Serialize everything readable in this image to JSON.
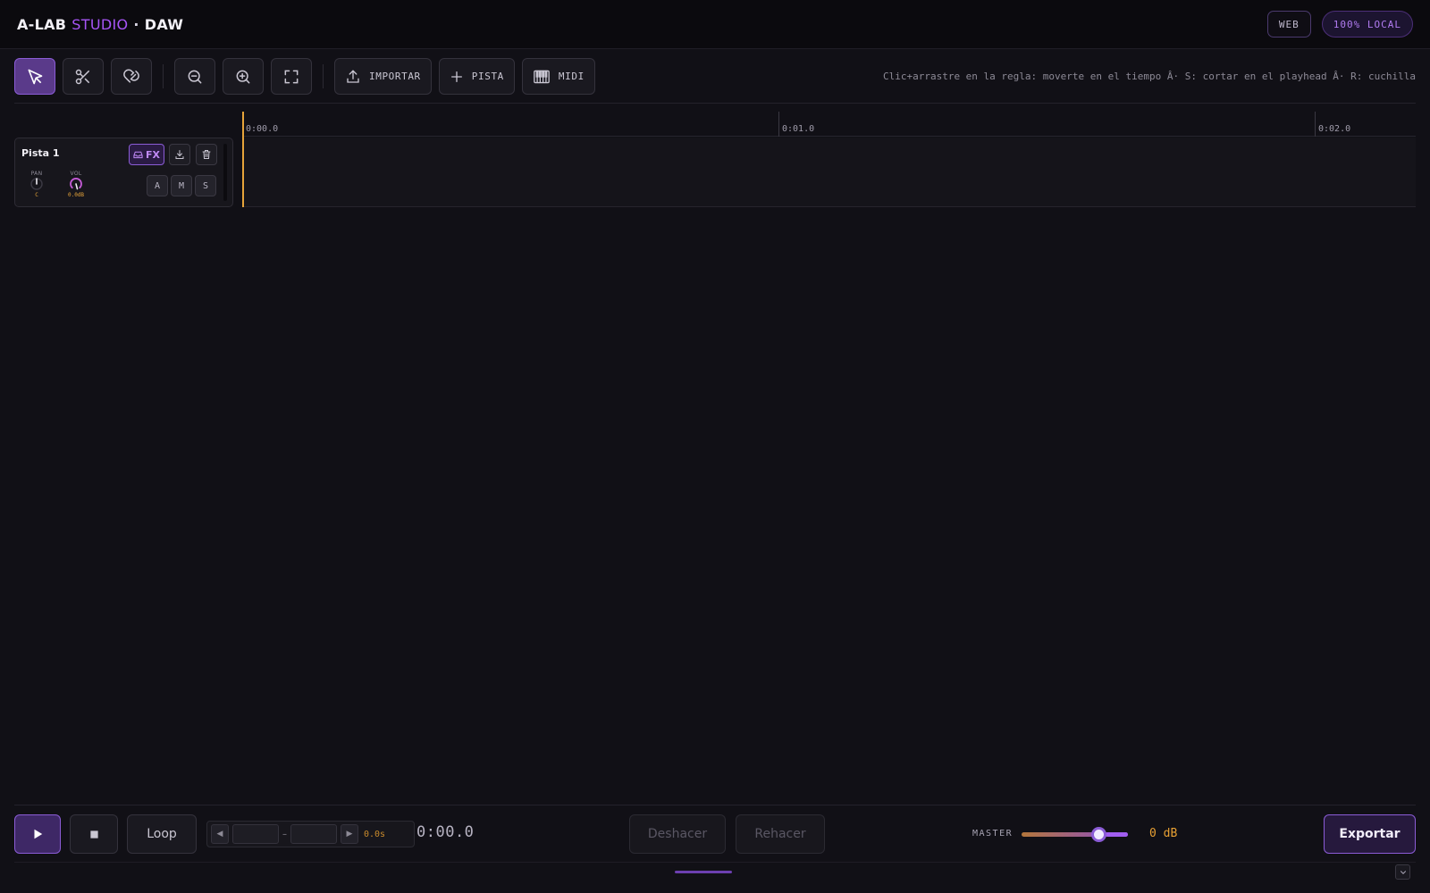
{
  "header": {
    "brand_main": "A-LAB",
    "brand_accent": "STUDIO",
    "brand_sep": "·",
    "brand_suffix": "DAW",
    "badge_web": "WEB",
    "badge_local": "100% LOCAL"
  },
  "toolbar": {
    "tools": [
      {
        "name": "select-tool",
        "icon": "cursor-arrow-icon",
        "active": true
      },
      {
        "name": "cut-tool",
        "icon": "scissors-icon",
        "active": false
      },
      {
        "name": "snap-tool",
        "icon": "magnet-icon",
        "active": false
      }
    ],
    "zoom": [
      {
        "name": "zoom-out",
        "icon": "zoom-out-icon"
      },
      {
        "name": "zoom-in",
        "icon": "zoom-in-icon"
      },
      {
        "name": "zoom-fit",
        "icon": "fit-to-screen-icon"
      }
    ],
    "import_label": "IMPORTAR",
    "add_track_label": "PISTA",
    "midi_label": "MIDI",
    "hint": "Clic+arrastre en la regla: moverte en el tiempo Â· S: cortar en el playhead Â· R: cuchilla"
  },
  "ruler": {
    "ticks": [
      "0:00.0",
      "0:01.0",
      "0:02.0"
    ]
  },
  "tracks": [
    {
      "name": "Pista 1",
      "fx_label": "FX",
      "pan_label": "PAN",
      "pan_value": "C",
      "vol_label": "VOL",
      "vol_value": "0.0dB",
      "buttons": [
        "A",
        "M",
        "S"
      ]
    }
  ],
  "transport": {
    "loop_label": "Loop",
    "range_dash": "–",
    "range_length": "0.0s",
    "time": "0:00.0",
    "undo_label": "Deshacer",
    "redo_label": "Rehacer",
    "master_label": "MASTER",
    "master_db": "0 dB",
    "master_level": 0.78,
    "export_label": "Exportar"
  },
  "colors": {
    "accent": "#a855f7",
    "playhead": "#e6a43a",
    "background": "#111016"
  }
}
